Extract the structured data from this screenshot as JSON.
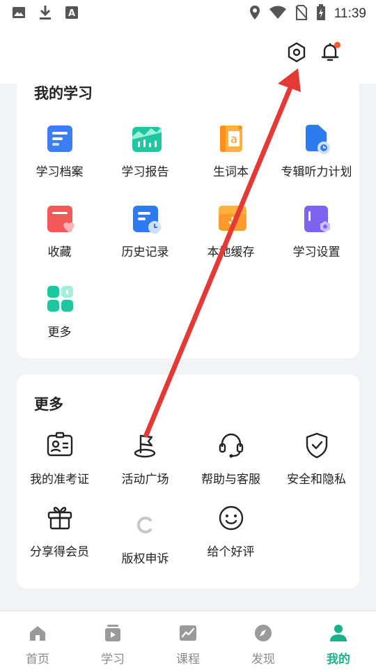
{
  "status_bar": {
    "time": "11:39",
    "left_icons": [
      "image-icon",
      "download-icon",
      "font-a-icon"
    ],
    "right_icons": [
      "location-icon",
      "wifi-icon",
      "sim-off-icon",
      "battery-charging-icon"
    ]
  },
  "header": {
    "settings_icon": "settings-hexagon-icon",
    "bell_icon": "bell-icon",
    "has_notification_dot": true
  },
  "my_learning": {
    "title": "我的学习",
    "items": [
      {
        "label": "学习档案",
        "icon": "profile-doc-icon"
      },
      {
        "label": "学习报告",
        "icon": "report-chart-icon"
      },
      {
        "label": "生词本",
        "icon": "vocab-book-icon"
      },
      {
        "label": "专辑听力计划",
        "icon": "listening-plan-icon"
      },
      {
        "label": "收藏",
        "icon": "favorite-icon"
      },
      {
        "label": "历史记录",
        "icon": "history-icon"
      },
      {
        "label": "本地缓存",
        "icon": "local-cache-icon"
      },
      {
        "label": "学习设置",
        "icon": "study-settings-icon"
      },
      {
        "label": "更多",
        "icon": "more-grid-icon"
      }
    ]
  },
  "more": {
    "title": "更多",
    "items": [
      {
        "label": "我的准考证",
        "icon": "admission-ticket-icon"
      },
      {
        "label": "活动广场",
        "icon": "flag-icon"
      },
      {
        "label": "帮助与客服",
        "icon": "headset-icon"
      },
      {
        "label": "安全和隐私",
        "icon": "shield-check-icon"
      },
      {
        "label": "分享得会员",
        "icon": "gift-icon"
      },
      {
        "label": "版权申诉",
        "icon": "loading-icon"
      },
      {
        "label": "给个好评",
        "icon": "smile-icon"
      }
    ]
  },
  "tabbar": {
    "tabs": [
      {
        "label": "首页",
        "icon": "home-icon"
      },
      {
        "label": "学习",
        "icon": "study-play-icon"
      },
      {
        "label": "课程",
        "icon": "course-chart-icon"
      },
      {
        "label": "发现",
        "icon": "compass-icon"
      },
      {
        "label": "我的",
        "icon": "person-icon"
      }
    ],
    "active": "我的"
  },
  "colors": {
    "accent": "#18b38a",
    "annotation_arrow": "#e53935",
    "notification_dot": "#ff5a2a"
  }
}
